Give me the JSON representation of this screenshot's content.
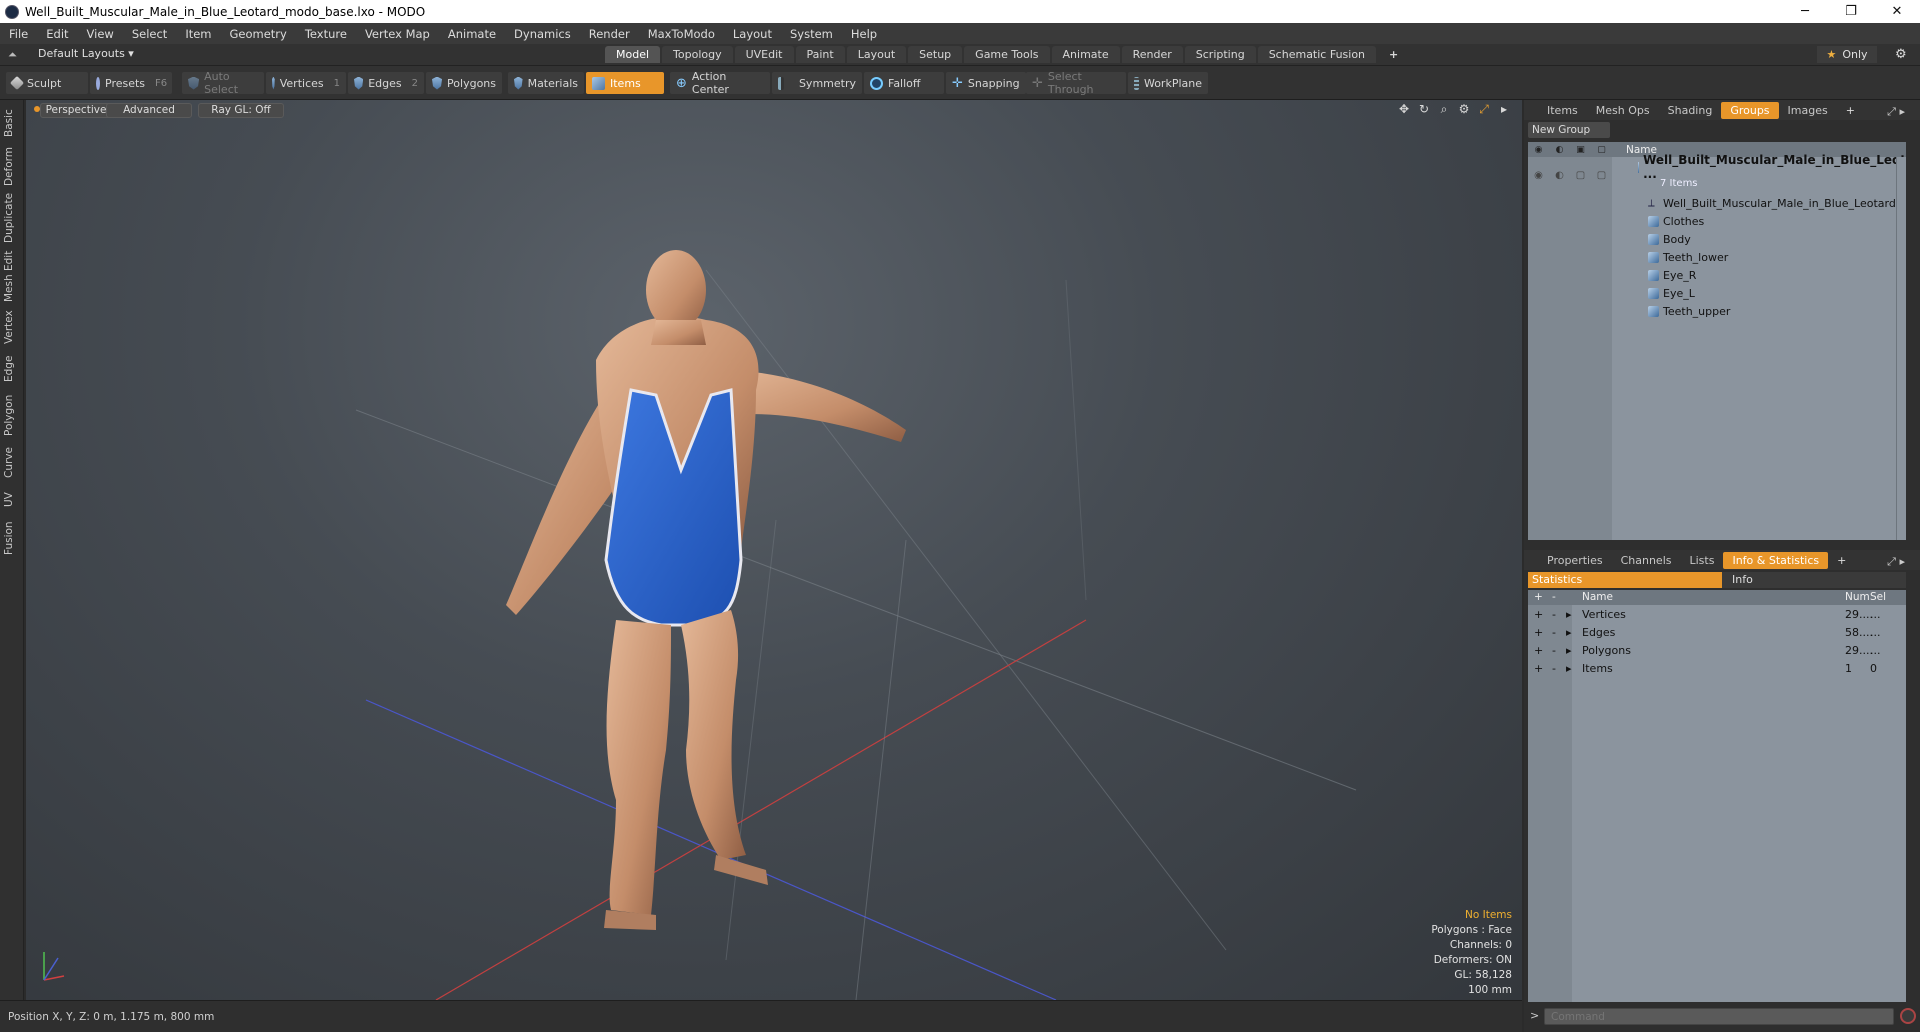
{
  "window": {
    "title": "Well_Built_Muscular_Male_in_Blue_Leotard_modo_base.lxo - MODO",
    "minimize": "─",
    "maximize": "❐",
    "close": "✕"
  },
  "menu": [
    "File",
    "Edit",
    "View",
    "Select",
    "Item",
    "Geometry",
    "Texture",
    "Vertex Map",
    "Animate",
    "Dynamics",
    "Render",
    "MaxToModo",
    "Layout",
    "System",
    "Help"
  ],
  "layoutbar": {
    "layouts_label": "Default Layouts ▾",
    "tabs": [
      "Model",
      "Topology",
      "UVEdit",
      "Paint",
      "Layout",
      "Setup",
      "Game Tools",
      "Animate",
      "Render",
      "Scripting",
      "Schematic Fusion"
    ],
    "active_tab": "Model",
    "plus": "+",
    "only_label": "Only"
  },
  "toolbar": {
    "sculpt": "Sculpt",
    "presets": "Presets",
    "presets_key": "F6",
    "auto_select": "Auto Select",
    "vertices": "Vertices",
    "vertices_key": "1",
    "edges": "Edges",
    "edges_key": "2",
    "polygons": "Polygons",
    "materials": "Materials",
    "items": "Items",
    "action_center": "Action Center",
    "symmetry": "Symmetry",
    "falloff": "Falloff",
    "snapping": "Snapping",
    "select_through": "Select Through",
    "workplane": "WorkPlane"
  },
  "left_tabs": [
    "Basic",
    "Deform",
    "Duplicate",
    "Mesh Edit",
    "Vertex",
    "Edge",
    "Polygon",
    "Curve",
    "UV",
    "Fusion"
  ],
  "viewport": {
    "view_mode": "Perspective",
    "shading": "Advanced",
    "raygl": "Ray GL: Off",
    "info": {
      "no_items": "No Items",
      "polygons": "Polygons : Face",
      "channels": "Channels: 0",
      "deformers": "Deformers: ON",
      "gl": "GL: 58,128",
      "grid": "100 mm"
    }
  },
  "status": {
    "position": "Position X, Y, Z:   0 m, 1.175 m, 800 mm"
  },
  "groups_panel": {
    "tabs": [
      "Items",
      "Mesh Ops",
      "Shading",
      "Groups",
      "Images"
    ],
    "active_tab": "Groups",
    "new_group": "New Group",
    "name_header": "Name",
    "group_name": "Well_Built_Muscular_Male_in_Blue_Leot ...",
    "group_count": "7 Items",
    "items": [
      "Well_Built_Muscular_Male_in_Blue_Leotard",
      "Clothes",
      "Body",
      "Teeth_lower",
      "Eye_R",
      "Eye_L",
      "Teeth_upper"
    ]
  },
  "stats_panel": {
    "tabs": [
      "Properties",
      "Channels",
      "Lists",
      "Info & Statistics"
    ],
    "active_tab": "Info & Statistics",
    "statistics_tab": "Statistics",
    "info_tab": "Info",
    "headers": {
      "name": "Name",
      "num": "Num",
      "sel": "Sel"
    },
    "rows": [
      {
        "name": "Vertices",
        "num": "29....",
        "sel": "..."
      },
      {
        "name": "Edges",
        "num": "58....",
        "sel": "..."
      },
      {
        "name": "Polygons",
        "num": "29....",
        "sel": "..."
      },
      {
        "name": "Items",
        "num": "1",
        "sel": "0"
      }
    ]
  },
  "command": {
    "prompt": ">",
    "placeholder": "Command"
  }
}
